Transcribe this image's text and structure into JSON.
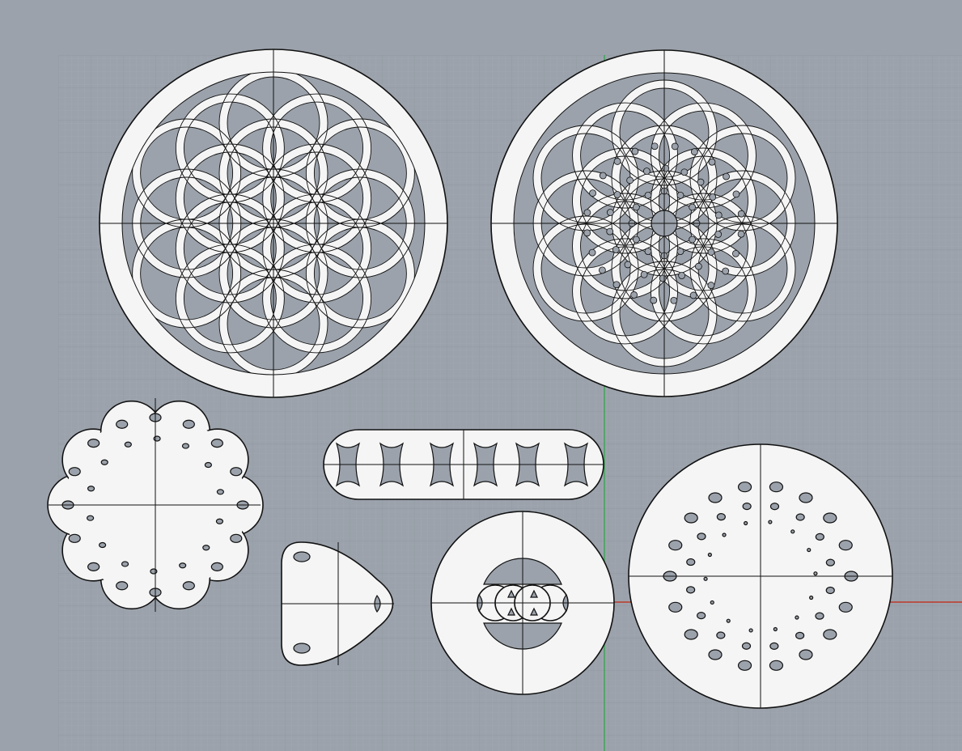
{
  "viewport": {
    "name": "top-viewport",
    "background": "#9ba2ab",
    "grid_minor_color": "#a3aab3",
    "grid_major_color": "#8f969f",
    "x_axis_color": "#c0392b",
    "y_axis_color": "#27ae60",
    "part_fill": "#f5f5f5",
    "part_stroke": "#111111"
  },
  "parts": [
    {
      "id": "large-flower-disc-a",
      "shape": "circle-pattern"
    },
    {
      "id": "large-flower-disc-b",
      "shape": "circle-pattern"
    },
    {
      "id": "scalloped-disc",
      "shape": "scalloped"
    },
    {
      "id": "ring-chain",
      "shape": "chain"
    },
    {
      "id": "triangle-lobe",
      "shape": "triangle"
    },
    {
      "id": "small-disc",
      "shape": "circle"
    },
    {
      "id": "medium-disc",
      "shape": "circle"
    }
  ]
}
